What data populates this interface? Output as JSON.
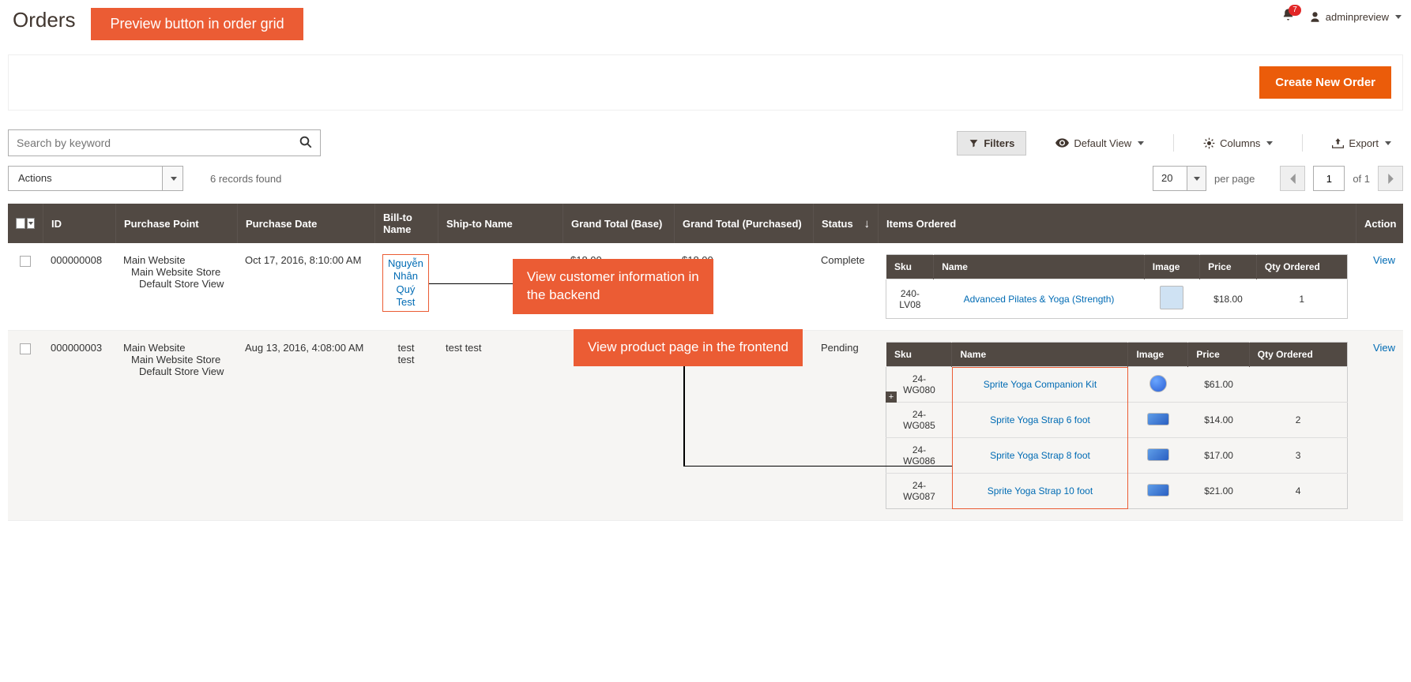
{
  "page": {
    "title": "Orders",
    "notif_count": "7",
    "username": "adminpreview"
  },
  "callouts": {
    "preview": "Preview button in order grid",
    "customer": "View customer information in the backend",
    "product": "View product page in the frontend"
  },
  "create_bar": {
    "create_order": "Create New Order"
  },
  "search": {
    "placeholder": "Search by keyword"
  },
  "toolbar": {
    "filters": "Filters",
    "default_view": "Default View",
    "columns": "Columns",
    "export": "Export"
  },
  "actions": {
    "label": "Actions",
    "records_found": "6 records found"
  },
  "pager": {
    "per_page": "20",
    "per_page_text": "per page",
    "page": "1",
    "of_text": "of 1"
  },
  "columns": {
    "id": "ID",
    "purchase_point": "Purchase Point",
    "purchase_date": "Purchase Date",
    "bill_to": "Bill-to Name",
    "ship_to": "Ship-to Name",
    "gt_base": "Grand Total (Base)",
    "gt_purchased": "Grand Total (Purchased)",
    "status": "Status",
    "items_ordered": "Items Ordered",
    "action": "Action"
  },
  "item_cols": {
    "sku": "Sku",
    "name": "Name",
    "image": "Image",
    "price": "Price",
    "qty": "Qty Ordered"
  },
  "rows": [
    {
      "id": "000000008",
      "pp1": "Main Website",
      "pp2": "Main Website Store",
      "pp3": "Default Store View",
      "date": "Oct 17, 2016, 8:10:00 AM",
      "bill_highlight": true,
      "bill_l1": "Nguyễn",
      "bill_l2": "Nhân",
      "bill_l3": "Quý",
      "bill_l4": "Test",
      "ship": "",
      "gtb": "$18.00",
      "gtp": "$18.00",
      "status": "Complete",
      "items": [
        {
          "sku": "240-LV08",
          "name": "Advanced Pilates & Yoga (Strength)",
          "price": "$18.00",
          "qty": "1",
          "thumb": "dvd"
        }
      ],
      "action": "View"
    },
    {
      "id": "000000003",
      "pp1": "Main Website",
      "pp2": "Main Website Store",
      "pp3": "Default Store View",
      "date": "Aug 13, 2016, 4:08:00 AM",
      "bill_highlight": false,
      "bill_l1": "test",
      "bill_l2": "test",
      "bill_l3": "",
      "bill_l4": "",
      "ship": "test test",
      "gtb": "",
      "gtp": "",
      "status": "Pending",
      "items_highlight_name": true,
      "items": [
        {
          "sku": "24-WG080",
          "name": "Sprite Yoga Companion Kit",
          "price": "$61.00",
          "qty": "",
          "thumb": "ball",
          "expand": true
        },
        {
          "sku": "24-WG085",
          "name": "Sprite Yoga Strap 6 foot",
          "price": "$14.00",
          "qty": "2",
          "thumb": "strap"
        },
        {
          "sku": "24-WG086",
          "name": "Sprite Yoga Strap 8 foot",
          "price": "$17.00",
          "qty": "3",
          "thumb": "strap"
        },
        {
          "sku": "24-WG087",
          "name": "Sprite Yoga Strap 10 foot",
          "price": "$21.00",
          "qty": "4",
          "thumb": "strap"
        }
      ],
      "action": "View"
    }
  ]
}
